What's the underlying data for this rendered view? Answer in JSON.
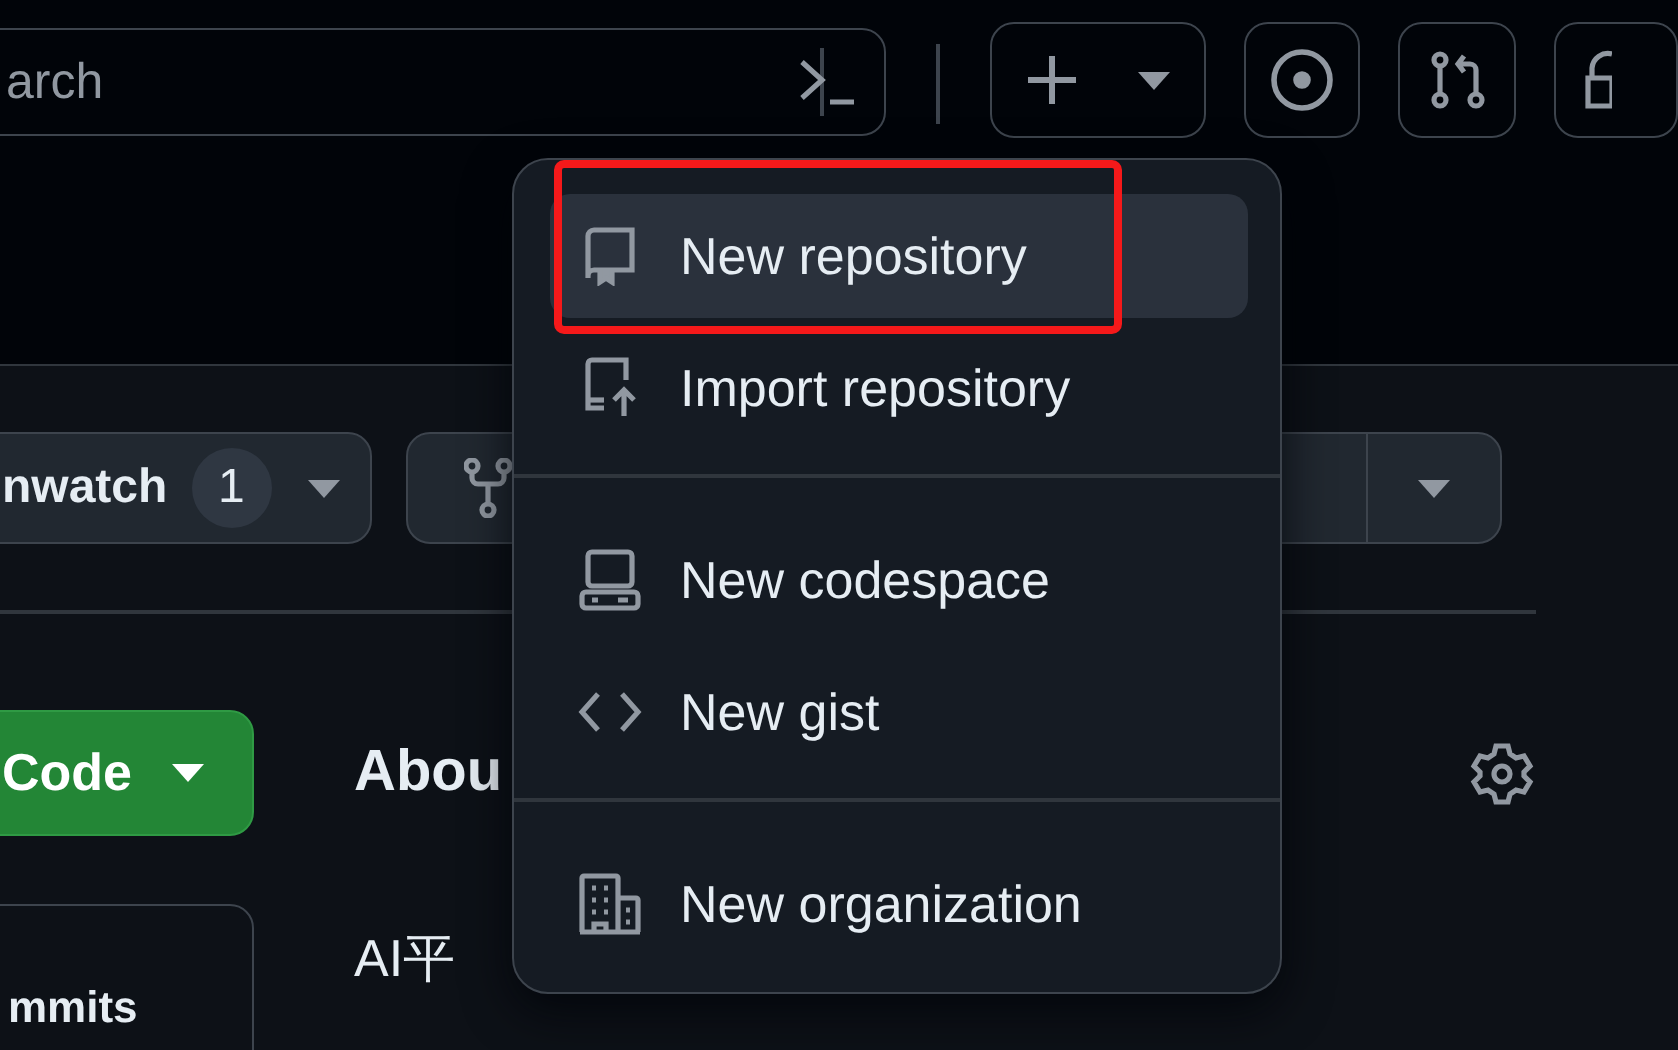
{
  "header": {
    "search": {
      "placeholder": "arch"
    }
  },
  "repo_actions": {
    "watch": {
      "label": "nwatch",
      "count": "1"
    }
  },
  "menu": {
    "groups": [
      [
        {
          "kind": "repo",
          "label": "New repository",
          "selected": true
        },
        {
          "kind": "import",
          "label": "Import repository",
          "selected": false
        }
      ],
      [
        {
          "kind": "codespace",
          "label": "New codespace",
          "selected": false
        },
        {
          "kind": "gist",
          "label": "New gist",
          "selected": false
        }
      ],
      [
        {
          "kind": "organization",
          "label": "New organization",
          "selected": false
        }
      ]
    ]
  },
  "code_button": {
    "label": "Code"
  },
  "about": {
    "title": "Abou",
    "description": "AI平"
  },
  "commits": {
    "label": "mmits"
  }
}
